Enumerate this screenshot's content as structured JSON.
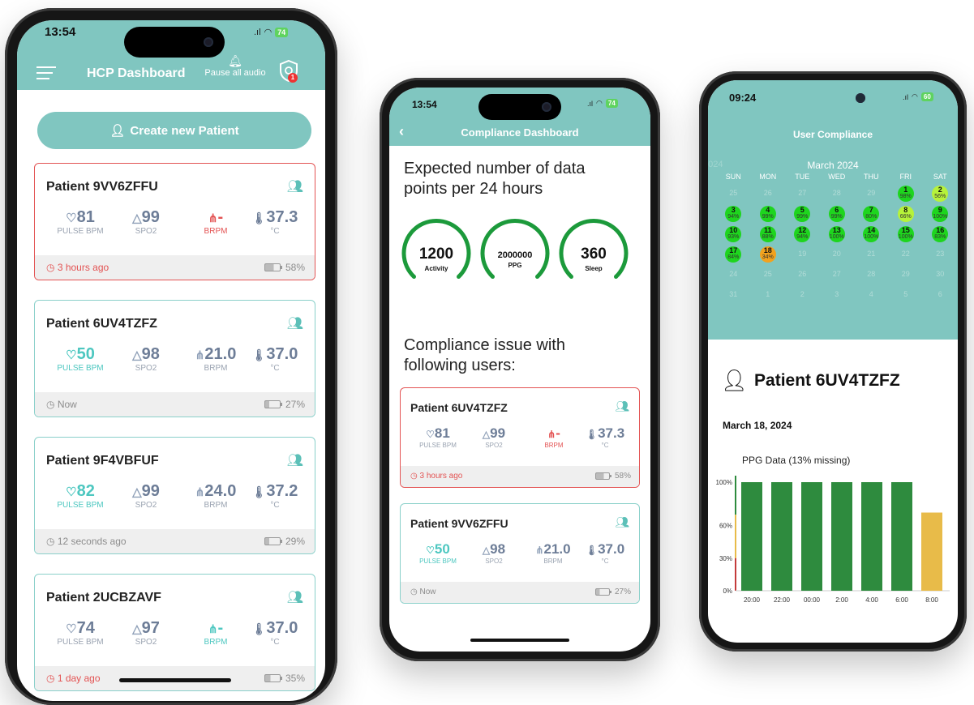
{
  "phone1": {
    "time": "13:54",
    "battery": "74",
    "title": "HCP Dashboard",
    "pause_label": "Pause all audio",
    "notif_count": "1",
    "create_label": "Create new Patient",
    "patients": [
      {
        "name": "Patient 9VV6ZFFU",
        "pulse": "81",
        "spo2": "99",
        "brpm": "-",
        "temp": "37.3",
        "pulse_label": "PULSE BPM",
        "spo2_label": "SPO2",
        "brpm_label": "BRPM",
        "temp_label": "°C",
        "ago": "3 hours ago",
        "battery": "58%"
      },
      {
        "name": "Patient 6UV4TZFZ",
        "pulse": "50",
        "spo2": "98",
        "brpm": "21.0",
        "temp": "37.0",
        "pulse_label": "PULSE BPM",
        "spo2_label": "SPO2",
        "brpm_label": "BRPM",
        "temp_label": "°C",
        "ago": "Now",
        "battery": "27%"
      },
      {
        "name": "Patient 9F4VBFUF",
        "pulse": "82",
        "spo2": "99",
        "brpm": "24.0",
        "temp": "37.2",
        "pulse_label": "PULSE BPM",
        "spo2_label": "SPO2",
        "brpm_label": "BRPM",
        "temp_label": "°C",
        "ago": "12 seconds ago",
        "battery": "29%"
      },
      {
        "name": "Patient 2UCBZAVF",
        "pulse": "74",
        "spo2": "97",
        "brpm": "-",
        "temp": "37.0",
        "pulse_label": "PULSE BPM",
        "spo2_label": "SPO2",
        "brpm_label": "BRPM",
        "temp_label": "°C",
        "ago": "1 day ago",
        "battery": "35%"
      }
    ]
  },
  "phone2": {
    "time": "13:54",
    "battery": "74",
    "title": "Compliance Dashboard",
    "heading": "Expected number of data points per 24 hours",
    "gauges": [
      {
        "value": "1200",
        "label": "Activity"
      },
      {
        "value": "2000000",
        "label": "PPG"
      },
      {
        "value": "360",
        "label": "Sleep"
      }
    ],
    "issue_heading": "Compliance issue with following users:",
    "patients": [
      {
        "name": "Patient 6UV4TZFZ",
        "pulse": "81",
        "spo2": "99",
        "brpm": "-",
        "temp": "37.3",
        "pulse_label": "PULSE BPM",
        "spo2_label": "SPO2",
        "brpm_label": "BRPM",
        "temp_label": "°C",
        "ago": "3 hours ago",
        "battery": "58%"
      },
      {
        "name": "Patient 9VV6ZFFU",
        "pulse": "50",
        "spo2": "98",
        "brpm": "21.0",
        "temp": "37.0",
        "pulse_label": "PULSE BPM",
        "spo2_label": "SPO2",
        "brpm_label": "BRPM",
        "temp_label": "°C",
        "ago": "Now",
        "battery": "27%"
      }
    ]
  },
  "phone3": {
    "time": "09:24",
    "battery": "60",
    "title": "User Compliance",
    "ghost_year": "2024",
    "month": "March 2024",
    "weekdays": [
      "SUN",
      "MON",
      "TUE",
      "WED",
      "THU",
      "FRI",
      "SAT"
    ],
    "weeks": [
      [
        "25",
        "26",
        "27",
        "28",
        "29",
        "1",
        "2"
      ],
      [
        "3",
        "4",
        "5",
        "6",
        "7",
        "8",
        "9"
      ],
      [
        "10",
        "11",
        "12",
        "13",
        "14",
        "15",
        "16"
      ],
      [
        "17",
        "18",
        "19",
        "20",
        "21",
        "22",
        "23"
      ],
      [
        "24",
        "25",
        "26",
        "27",
        "28",
        "29",
        "30"
      ],
      [
        "31",
        "1",
        "2",
        "3",
        "4",
        "5",
        "6"
      ]
    ],
    "compliance": {
      "1": "98%",
      "2": "56%",
      "3": "94%",
      "4": "99%",
      "5": "99%",
      "6": "99%",
      "7": "80%",
      "8": "66%",
      "9": "100%",
      "10": "93%",
      "11": "88%",
      "12": "94%",
      "13": "100%",
      "14": "100%",
      "15": "100%",
      "16": "83%",
      "17": "84%",
      "18": "34%"
    },
    "patient_name": "Patient 6UV4TZFZ",
    "date": "March 18, 2024",
    "colors": {
      "high": "#1ed51e",
      "mid": "#b6f23a",
      "low": "#f2a21e"
    }
  },
  "chart_data": {
    "type": "bar",
    "title": "PPG Data (13% missing)",
    "categories": [
      "20:00",
      "22:00",
      "00:00",
      "2:00",
      "4:00",
      "6:00",
      "8:00"
    ],
    "values": [
      100,
      100,
      100,
      100,
      100,
      100,
      72
    ],
    "bar_colors": [
      "#2e8b3e",
      "#2e8b3e",
      "#2e8b3e",
      "#2e8b3e",
      "#2e8b3e",
      "#2e8b3e",
      "#e8bb49"
    ],
    "y_ticks": [
      "100%",
      "60%",
      "30%",
      "0%"
    ],
    "ylim": [
      0,
      100
    ]
  }
}
